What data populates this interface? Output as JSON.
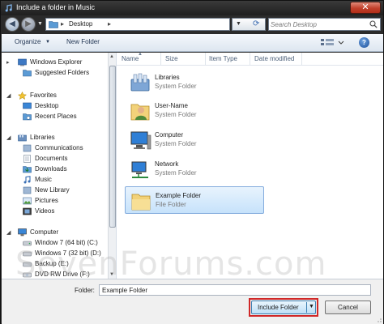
{
  "window": {
    "title": "Include a folder in Music",
    "close_glyph": "✕"
  },
  "address": {
    "crumb": "Desktop",
    "search_placeholder": "Search Desktop"
  },
  "toolbar": {
    "organize_label": "Organize",
    "new_folder_label": "New Folder",
    "help_glyph": "?"
  },
  "nav": {
    "favorites_root": {
      "label": "Windows Explorer",
      "icon": "explorer-icon"
    },
    "favorites_children": [
      {
        "label": "Suggested Folders",
        "icon": "folder-icon"
      }
    ],
    "favorites": {
      "label": "Favorites",
      "icon": "star-icon"
    },
    "favorite_items": [
      {
        "label": "Desktop",
        "icon": "desktop-icon"
      },
      {
        "label": "Recent Places",
        "icon": "recent-places-icon"
      }
    ],
    "libraries": {
      "label": "Libraries",
      "icon": "libraries-icon"
    },
    "library_items": [
      {
        "label": "Communications",
        "icon": "library-icon"
      },
      {
        "label": "Documents",
        "icon": "documents-icon"
      },
      {
        "label": "Downloads",
        "icon": "downloads-icon"
      },
      {
        "label": "Music",
        "icon": "music-icon"
      },
      {
        "label": "New Library",
        "icon": "library-icon"
      },
      {
        "label": "Pictures",
        "icon": "pictures-icon"
      },
      {
        "label": "Videos",
        "icon": "videos-icon"
      }
    ],
    "computer": {
      "label": "Computer",
      "icon": "computer-icon"
    },
    "drives": [
      {
        "label": "Window 7 (64 bit) (C:)",
        "icon": "drive-icon"
      },
      {
        "label": "Windows 7 (32 bit) (D:)",
        "icon": "drive-icon"
      },
      {
        "label": "Backup (E:)",
        "icon": "drive-icon"
      },
      {
        "label": "DVD RW Drive (F:)",
        "icon": "dvd-icon"
      }
    ]
  },
  "columns": {
    "name": "Name",
    "size": "Size",
    "item_type": "Item Type",
    "date_modified": "Date modified"
  },
  "files": [
    {
      "name": "Libraries",
      "type": "System Folder",
      "icon": "libraries-icon"
    },
    {
      "name": "User-Name",
      "type": "System Folder",
      "icon": "user-folder-icon"
    },
    {
      "name": "Computer",
      "type": "System Folder",
      "icon": "computer-icon"
    },
    {
      "name": "Network",
      "type": "System Folder",
      "icon": "network-icon"
    },
    {
      "name": "Example Folder",
      "type": "File Folder",
      "icon": "folder-icon",
      "selected": true
    }
  ],
  "bottom": {
    "folder_label": "Folder:",
    "folder_value": "Example Folder",
    "include_label": "Include Folder",
    "cancel_label": "Cancel"
  },
  "watermark": "SevenForums.com",
  "colors": {
    "highlight": "#d02828",
    "selection": "#c6e2fb",
    "title_bar": "#2b2b2b"
  }
}
